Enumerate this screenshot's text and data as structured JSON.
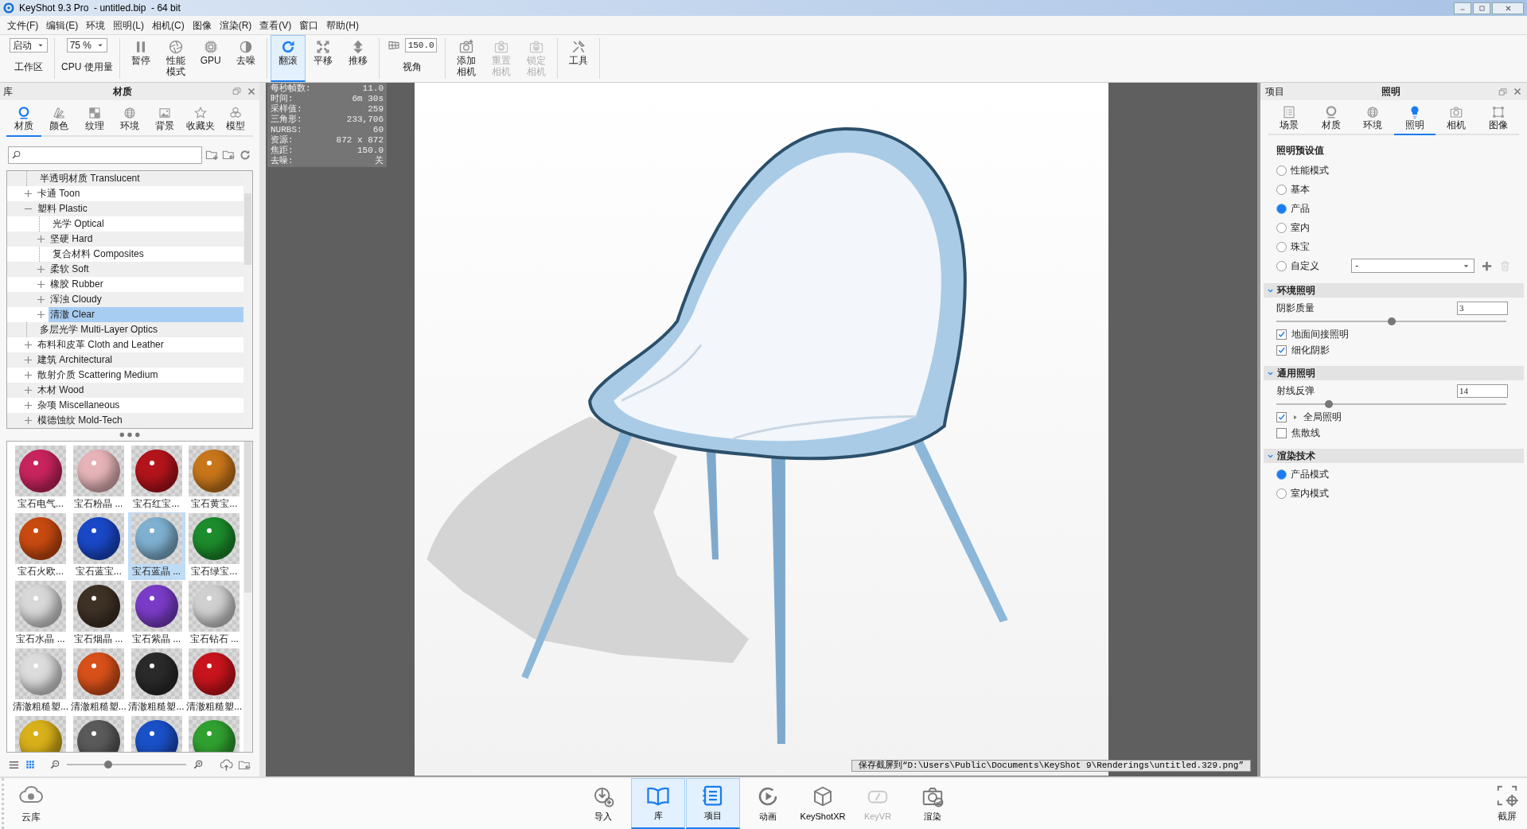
{
  "window": {
    "title": "KeyShot 9.3 Pro  - untitled.bip  - 64 bit"
  },
  "menu": [
    "文件(F)",
    "编辑(E)",
    "环境",
    "照明(L)",
    "相机(C)",
    "图像",
    "渲染(R)",
    "查看(V)",
    "窗口",
    "帮助(H)"
  ],
  "toolbar": [
    {
      "kind": "dropdown",
      "value": "启动",
      "label": "工作区"
    },
    {
      "kind": "dropdown",
      "value": "75 %",
      "label": "CPU 使用量"
    },
    {
      "kind": "button",
      "label": "暂停",
      "selected": false,
      "disabled": false
    },
    {
      "kind": "button",
      "label": "性能模式",
      "selected": false,
      "disabled": false
    },
    {
      "kind": "button",
      "label": "GPU",
      "selected": false,
      "disabled": false
    },
    {
      "kind": "button",
      "label": "去噪",
      "selected": false,
      "disabled": false
    },
    {
      "kind": "button",
      "label": "翻滚",
      "selected": true,
      "disabled": false
    },
    {
      "kind": "button",
      "label": "平移",
      "selected": false,
      "disabled": false
    },
    {
      "kind": "button",
      "label": "推移",
      "selected": false,
      "disabled": false
    },
    {
      "kind": "field",
      "value": "150.0",
      "label": "视角"
    },
    {
      "kind": "button",
      "label": "添加相机",
      "selected": false,
      "disabled": false
    },
    {
      "kind": "button",
      "label": "重置相机",
      "selected": false,
      "disabled": true
    },
    {
      "kind": "button",
      "label": "锁定相机",
      "selected": false,
      "disabled": true
    },
    {
      "kind": "button",
      "label": "工具",
      "selected": false,
      "disabled": false
    }
  ],
  "library": {
    "title": "库",
    "panel_title": "材质",
    "tabs": [
      {
        "label": "材质",
        "selected": true
      },
      {
        "label": "颜色",
        "selected": false
      },
      {
        "label": "纹理",
        "selected": false
      },
      {
        "label": "环境",
        "selected": false
      },
      {
        "label": "背景",
        "selected": false
      },
      {
        "label": "收藏夹",
        "selected": false
      },
      {
        "label": "模型",
        "selected": false
      }
    ],
    "tree": [
      {
        "label": "半透明材质 Translucent",
        "kind": "leaf",
        "selected": false
      },
      {
        "label": "卡通 Toon",
        "kind": "folder",
        "expanded": false,
        "selected": false
      },
      {
        "label": "塑料 Plastic",
        "kind": "folder",
        "expanded": true,
        "selected": false,
        "children": [
          {
            "label": "光学 Optical",
            "kind": "leaf",
            "selected": false
          },
          {
            "label": "坚硬 Hard",
            "kind": "folder",
            "expanded": false,
            "selected": false
          },
          {
            "label": "复合材料 Composites",
            "kind": "leaf",
            "selected": false
          },
          {
            "label": "柔软 Soft",
            "kind": "folder",
            "expanded": false,
            "selected": false
          },
          {
            "label": "橡胶 Rubber",
            "kind": "folder",
            "expanded": false,
            "selected": false
          },
          {
            "label": "浑浊 Cloudy",
            "kind": "folder",
            "expanded": false,
            "selected": false
          },
          {
            "label": "清澈 Clear",
            "kind": "folder",
            "expanded": false,
            "selected": true
          }
        ]
      },
      {
        "label": "多层光学 Multi-Layer Optics",
        "kind": "leaf",
        "selected": false
      },
      {
        "label": "布料和皮革 Cloth and Leather",
        "kind": "folder",
        "expanded": false,
        "selected": false
      },
      {
        "label": "建筑 Architectural",
        "kind": "folder",
        "expanded": false,
        "selected": false
      },
      {
        "label": "散射介质 Scattering Medium",
        "kind": "folder",
        "expanded": false,
        "selected": false
      },
      {
        "label": "木材 Wood",
        "kind": "folder",
        "expanded": false,
        "selected": false
      },
      {
        "label": "杂项 Miscellaneous",
        "kind": "folder",
        "expanded": false,
        "selected": false
      },
      {
        "label": "模德蚀纹 Mold-Tech",
        "kind": "folder",
        "expanded": false,
        "selected": false
      }
    ],
    "materials": [
      {
        "label": "宝石电气...",
        "color": "#c8245e",
        "selected": false
      },
      {
        "label": "宝石粉晶 ...",
        "color": "#e6b4b8",
        "selected": false
      },
      {
        "label": "宝石红宝...",
        "color": "#b3141c",
        "selected": false
      },
      {
        "label": "宝石黄宝...",
        "color": "#c8761a",
        "selected": false
      },
      {
        "label": "宝石火欧...",
        "color": "#c84a10",
        "selected": false
      },
      {
        "label": "宝石蓝宝...",
        "color": "#1a48c8",
        "selected": false
      },
      {
        "label": "宝石蓝晶 ...",
        "color": "#7fb0d0",
        "selected": true
      },
      {
        "label": "宝石绿宝...",
        "color": "#1c8c2c",
        "selected": false
      },
      {
        "label": "宝石水晶 ...",
        "color": "#d8d8d8",
        "selected": false
      },
      {
        "label": "宝石烟晶 ...",
        "color": "#3e3126",
        "selected": false
      },
      {
        "label": "宝石紫晶 ...",
        "color": "#7a3cc8",
        "selected": false
      },
      {
        "label": "宝石钻石 ...",
        "color": "#d0d0d0",
        "selected": false
      },
      {
        "label": "清澈粗糙塑...",
        "color": "#dcdcdc",
        "selected": false
      },
      {
        "label": "清澈粗糙塑...",
        "color": "#d8501a",
        "selected": false
      },
      {
        "label": "清澈粗糙塑...",
        "color": "#2a2a2a",
        "selected": false
      },
      {
        "label": "清澈粗糙塑...",
        "color": "#c8141c",
        "selected": false
      },
      {
        "color": "#d8b01a",
        "selected": false
      },
      {
        "color": "#5a5a5a",
        "selected": false
      },
      {
        "color": "#1a50c8",
        "selected": false
      },
      {
        "color": "#30a030",
        "selected": false
      }
    ],
    "zoom": {
      "level": 0.35
    }
  },
  "viewport": {
    "stats": [
      {
        "label": "每秒帧数:",
        "value": "11.0"
      },
      {
        "label": "时间:",
        "value": "6m 30s"
      },
      {
        "label": "采样值:",
        "value": "259"
      },
      {
        "label": "三角形:",
        "value": "233,706"
      },
      {
        "label": "NURBS:",
        "value": "60"
      },
      {
        "label": "资源:",
        "value": "872 x 872"
      },
      {
        "label": "焦距:",
        "value": "150.0"
      },
      {
        "label": "去噪:",
        "value": "关"
      }
    ],
    "status_message": "保存截屏到“D:\\Users\\Public\\Documents\\KeyShot 9\\Renderings\\untitled.329.png”"
  },
  "project": {
    "title": "项目",
    "panel_title": "照明",
    "tabs": [
      {
        "label": "场景",
        "selected": false
      },
      {
        "label": "材质",
        "selected": false
      },
      {
        "label": "环境",
        "selected": false
      },
      {
        "label": "照明",
        "selected": true
      },
      {
        "label": "相机",
        "selected": false
      },
      {
        "label": "图像",
        "selected": false
      }
    ],
    "presets": {
      "heading": "照明预设值",
      "options": [
        {
          "label": "性能模式",
          "selected": false
        },
        {
          "label": "基本",
          "selected": false
        },
        {
          "label": "产品",
          "selected": true
        },
        {
          "label": "室内",
          "selected": false
        },
        {
          "label": "珠宝",
          "selected": false
        },
        {
          "label": "自定义",
          "selected": false
        }
      ],
      "custom_dropdown": "-"
    },
    "sections": [
      {
        "title": "环境照明",
        "expanded": true,
        "rows": [
          {
            "kind": "slider",
            "label": "阴影质量",
            "value": "3",
            "level": 0.5
          },
          {
            "kind": "checkbox",
            "label": "地面间接照明",
            "checked": true,
            "expandable": false
          },
          {
            "kind": "checkbox",
            "label": "细化阴影",
            "checked": true,
            "expandable": false
          }
        ]
      },
      {
        "title": "通用照明",
        "expanded": true,
        "rows": [
          {
            "kind": "slider",
            "label": "射线反弹",
            "value": "14",
            "level": 0.23
          },
          {
            "kind": "checkbox",
            "label": "全局照明",
            "checked": true,
            "expandable": true
          },
          {
            "kind": "checkbox",
            "label": "焦散线",
            "checked": false,
            "expandable": false
          }
        ]
      },
      {
        "title": "渲染技术",
        "expanded": true,
        "rows": [
          {
            "kind": "radio",
            "label": "产品模式",
            "selected": true
          },
          {
            "kind": "radio",
            "label": "室内模式",
            "selected": false
          }
        ]
      }
    ]
  },
  "dock": {
    "left": [
      {
        "label": "云库"
      }
    ],
    "center": [
      {
        "label": "导入",
        "selected": false,
        "disabled": false
      },
      {
        "label": "库",
        "selected": true,
        "disabled": false
      },
      {
        "label": "项目",
        "selected": true,
        "disabled": false
      },
      {
        "label": "动画",
        "selected": false,
        "disabled": false
      },
      {
        "label": "KeyShotXR",
        "selected": false,
        "disabled": false
      },
      {
        "label": "KeyVR",
        "selected": false,
        "disabled": true
      },
      {
        "label": "渲染",
        "selected": false,
        "disabled": false
      }
    ],
    "right": [
      {
        "label": "截屏"
      }
    ]
  }
}
